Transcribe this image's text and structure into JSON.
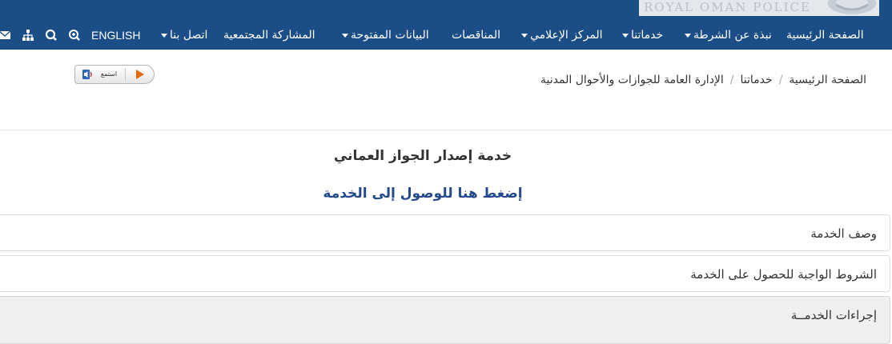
{
  "brand": {
    "text": "ROYAL OMAN POLICE"
  },
  "nav": {
    "items": [
      {
        "label": "الصفحة الرئيسية",
        "has_dropdown": false
      },
      {
        "label": "نبذة عن الشرطة",
        "has_dropdown": true
      },
      {
        "label": "خدماتنا",
        "has_dropdown": true
      },
      {
        "label": "المركز الإعلامي",
        "has_dropdown": true
      },
      {
        "label": "المناقصات",
        "has_dropdown": false
      },
      {
        "label": "البيانات المفتوحة",
        "has_dropdown": true
      },
      {
        "label": "المشاركة المجتمعية",
        "has_dropdown": false
      },
      {
        "label": "اتصل بنا",
        "has_dropdown": true
      },
      {
        "label": "ENGLISH",
        "has_dropdown": false
      }
    ],
    "icons": [
      "zoom-in-icon",
      "search-icon",
      "sitemap-icon",
      "mail-icon"
    ],
    "background_color": "#1b4d86"
  },
  "breadcrumb": {
    "items": [
      "الصفحة الرئيسية",
      "خدماتنا",
      "الإدارة العامة للجوازات والأحوال المدنية"
    ],
    "separator": "/"
  },
  "listen": {
    "label": "استمع",
    "icon": "speaker-icon",
    "play_icon": "play-icon"
  },
  "service": {
    "title": "خدمة إصدار الجواز العماني",
    "link": "إضغط هنا للوصول إلى الخدمة",
    "link_color": "#234a8c"
  },
  "panels": [
    {
      "title": "وصف الخدمة"
    },
    {
      "title": "الشروط الواجبة للحصول على الخدمة"
    },
    {
      "title": "إجراءات الخدمــة"
    }
  ]
}
